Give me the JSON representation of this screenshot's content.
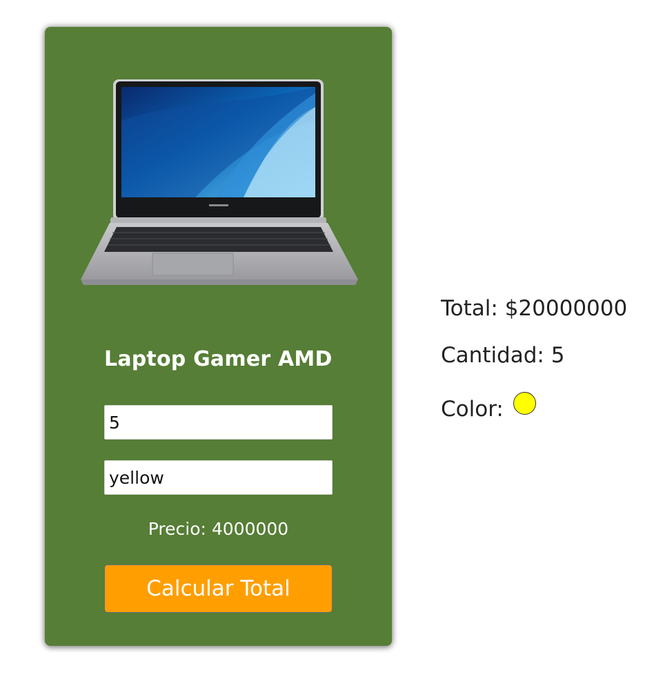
{
  "product": {
    "name": "Laptop Gamer AMD",
    "image": "laptop-image",
    "quantity_value": "5",
    "color_value": "yellow",
    "price_label": "Precio: 4000000",
    "button_label": "Calcular Total"
  },
  "summary": {
    "total_label": "Total: $20000000",
    "quantity_label": "Cantidad: 5",
    "color_label": "Color:",
    "color_swatch": "#ffff00"
  },
  "colors": {
    "card": "#567e36",
    "button": "#ff9e00"
  }
}
